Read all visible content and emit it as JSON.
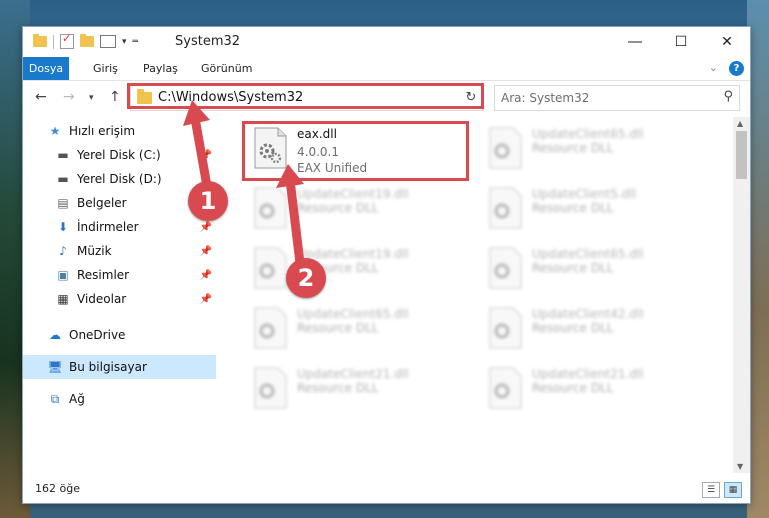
{
  "window": {
    "title": "System32"
  },
  "ribbon": {
    "tabs": [
      "Dosya",
      "Giriş",
      "Paylaş",
      "Görünüm"
    ]
  },
  "address": {
    "path": "C:\\Windows\\System32"
  },
  "search": {
    "placeholder": "Ara: System32"
  },
  "nav": {
    "items": [
      {
        "label": "Hızlı erişim",
        "icon": "star-icon"
      },
      {
        "label": "Yerel Disk (C:)",
        "icon": "drive-icon"
      },
      {
        "label": "Yerel Disk (D:)",
        "icon": "drive-icon"
      },
      {
        "label": "Belgeler",
        "icon": "document-icon"
      },
      {
        "label": "İndirmeler",
        "icon": "download-icon"
      },
      {
        "label": "Müzik",
        "icon": "music-icon"
      },
      {
        "label": "Resimler",
        "icon": "picture-icon"
      },
      {
        "label": "Videolar",
        "icon": "video-icon"
      },
      {
        "label": "OneDrive",
        "icon": "cloud-icon"
      },
      {
        "label": "Bu bilgisayar",
        "icon": "computer-icon"
      },
      {
        "label": "Ağ",
        "icon": "network-icon"
      }
    ]
  },
  "files": [
    {
      "name": "eax.dll",
      "version": "4.0.0.1",
      "desc": "EAX Unified"
    },
    {
      "name": "UpdateClient65.dll",
      "desc": "Resource DLL"
    },
    {
      "name": "UpdateClient19.dll",
      "desc": "Resource DLL"
    },
    {
      "name": "UpdateClient5.dll",
      "desc": "Resource DLL"
    },
    {
      "name": "UpdateClient19.dll",
      "desc": "Resource DLL"
    },
    {
      "name": "UpdateClient65.dll",
      "desc": "Resource DLL"
    },
    {
      "name": "UpdateClient65.dll",
      "desc": "Resource DLL"
    },
    {
      "name": "UpdateClient42.dll",
      "desc": "Resource DLL"
    },
    {
      "name": "UpdateClient21.dll",
      "desc": "Resource DLL"
    },
    {
      "name": "UpdateClient21.dll",
      "desc": "Resource DLL"
    }
  ],
  "status": {
    "count": "162 öğe"
  },
  "markers": [
    "1",
    "2"
  ],
  "colors": {
    "accent": "#1979ca",
    "highlight": "#d84a4f",
    "selected": "#cce8ff"
  }
}
